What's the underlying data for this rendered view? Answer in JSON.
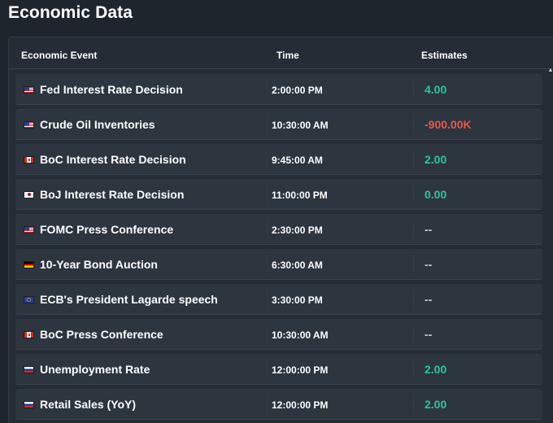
{
  "page": {
    "title": "Economic Data"
  },
  "table": {
    "headers": {
      "event": "Economic Event",
      "time": "Time",
      "estimates": "Estimates"
    },
    "rows": [
      {
        "flag": "flag-us",
        "event": "Fed Interest Rate Decision",
        "time": "2:00:00 PM",
        "estimate": "4.00",
        "tone": "positive"
      },
      {
        "flag": "flag-us",
        "event": "Crude Oil Inventories",
        "time": "10:30:00 AM",
        "estimate": "-900.00K",
        "tone": "negative"
      },
      {
        "flag": "flag-ca",
        "event": "BoC Interest Rate Decision",
        "time": "9:45:00 AM",
        "estimate": "2.00",
        "tone": "positive"
      },
      {
        "flag": "flag-jp",
        "event": "BoJ Interest Rate Decision",
        "time": "11:00:00 PM",
        "estimate": "0.00",
        "tone": "positive"
      },
      {
        "flag": "flag-us",
        "event": "FOMC Press Conference",
        "time": "2:30:00 PM",
        "estimate": "--",
        "tone": "none"
      },
      {
        "flag": "flag-de",
        "event": "10-Year Bond Auction",
        "time": "6:30:00 AM",
        "estimate": "--",
        "tone": "none"
      },
      {
        "flag": "flag-eu",
        "event": "ECB's President Lagarde speech",
        "time": "3:30:00 PM",
        "estimate": "--",
        "tone": "none"
      },
      {
        "flag": "flag-ca",
        "event": "BoC Press Conference",
        "time": "10:30:00 AM",
        "estimate": "--",
        "tone": "none"
      },
      {
        "flag": "flag-ru",
        "event": "Unemployment Rate",
        "time": "12:00:00 PM",
        "estimate": "2.00",
        "tone": "positive"
      },
      {
        "flag": "flag-ru",
        "event": "Retail Sales (YoY)",
        "time": "12:00:00 PM",
        "estimate": "2.00",
        "tone": "positive"
      }
    ]
  },
  "scrollbar": {
    "up_icon": "▲"
  },
  "colors": {
    "background": "#1f252d",
    "panel": "#252c35",
    "row": "#2d353f",
    "positive": "#2ec4a0",
    "negative": "#e8584a"
  }
}
